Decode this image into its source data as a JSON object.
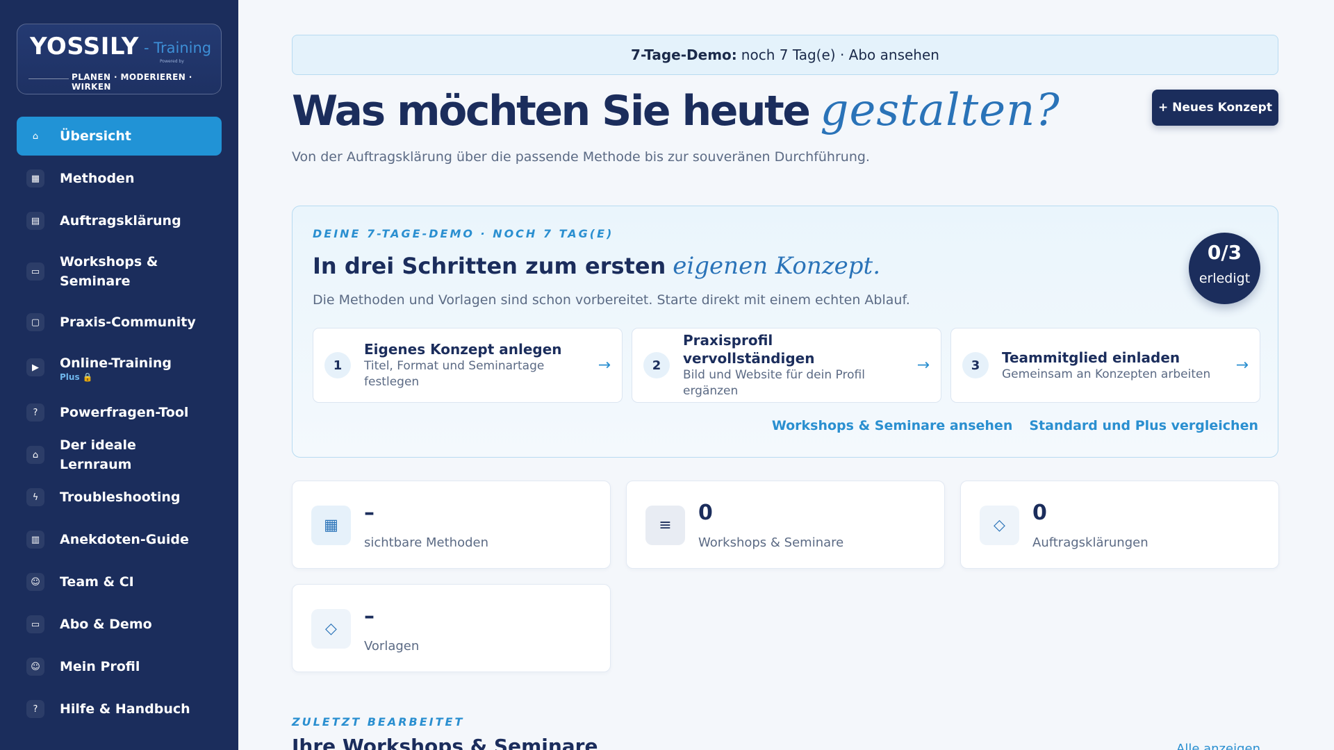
{
  "brand": {
    "name": "YOSSILY",
    "product": "- Training",
    "powered": "Powered by",
    "tagline": "PLANEN · MODERIEREN · WIRKEN"
  },
  "sidebar": {
    "items": [
      {
        "label": "Übersicht",
        "icon": "home-icon",
        "glyph": "⌂"
      },
      {
        "label": "Methoden",
        "icon": "grid-icon",
        "glyph": "▦"
      },
      {
        "label": "Auftragsklärung",
        "icon": "document-icon",
        "glyph": "▤"
      },
      {
        "label": "Workshops & Seminare",
        "icon": "calendar-icon",
        "glyph": "▭"
      },
      {
        "label": "Praxis-Community",
        "icon": "chat-icon",
        "glyph": "▢"
      },
      {
        "label": "Online-Training",
        "sublabel": "Plus 🔒",
        "icon": "play-icon",
        "glyph": "▶"
      },
      {
        "label": "Powerfragen-Tool",
        "icon": "question-icon",
        "glyph": "?"
      },
      {
        "label": "Der ideale Lernraum",
        "icon": "room-icon",
        "glyph": "⌂"
      },
      {
        "label": "Troubleshooting",
        "icon": "lightning-icon",
        "glyph": "ϟ"
      },
      {
        "label": "Anekdoten-Guide",
        "icon": "book-icon",
        "glyph": "▥"
      },
      {
        "label": "Team & CI",
        "icon": "users-icon",
        "glyph": "☺"
      },
      {
        "label": "Abo & Demo",
        "icon": "card-icon",
        "glyph": "▭"
      },
      {
        "label": "Mein Profil",
        "icon": "user-icon",
        "glyph": "☺"
      },
      {
        "label": "Hilfe & Handbuch",
        "icon": "help-icon",
        "glyph": "?"
      }
    ]
  },
  "banner": {
    "bold": "7-Tage-Demo:",
    "text": "noch 7 Tag(e) · Abo ansehen"
  },
  "hero": {
    "title": "Was möchten Sie heute",
    "title_script": "gestalten?",
    "subtitle": "Von der Auftragsklärung über die passende Methode bis zur souveränen Durchführung.",
    "new_button": "+ Neues Konzept"
  },
  "demo": {
    "eyebrow": "DEINE 7-TAGE-DEMO · NOCH 7 TAG(E)",
    "title": "In drei Schritten zum ersten",
    "title_script": "eigenen Konzept.",
    "subtitle": "Die Methoden und Vorlagen sind schon vorbereitet. Starte direkt mit einem echten Ablauf.",
    "progress_value": "0/3",
    "progress_label": "erledigt",
    "steps": [
      {
        "num": "1",
        "title": "Eigenes Konzept anlegen",
        "desc": "Titel, Format und Seminartage festlegen",
        "arrow": "→"
      },
      {
        "num": "2",
        "title": "Praxisprofil vervollständigen",
        "desc": "Bild und Website für dein Profil ergänzen",
        "arrow": "→"
      },
      {
        "num": "3",
        "title": "Teammitglied einladen",
        "desc": "Gemeinsam an Konzepten arbeiten",
        "arrow": "→"
      }
    ],
    "links": [
      "Workshops & Seminare ansehen",
      "Standard und Plus vergleichen"
    ]
  },
  "stats": [
    {
      "value": "–",
      "label": "sichtbare Methoden",
      "icon": "table-icon",
      "glyph": "▦"
    },
    {
      "value": "0",
      "label": "Workshops & Seminare",
      "icon": "list-icon",
      "glyph": "≡"
    },
    {
      "value": "0",
      "label": "Auftragsklärungen",
      "icon": "diamond-icon",
      "glyph": "◇"
    },
    {
      "value": "–",
      "label": "Vorlagen",
      "icon": "diamond-icon",
      "glyph": "◇"
    }
  ],
  "recent": {
    "eyebrow": "ZULETZT BEARBEITET",
    "title": "Ihre Workshops & Seminare",
    "link": "Alle anzeigen"
  }
}
